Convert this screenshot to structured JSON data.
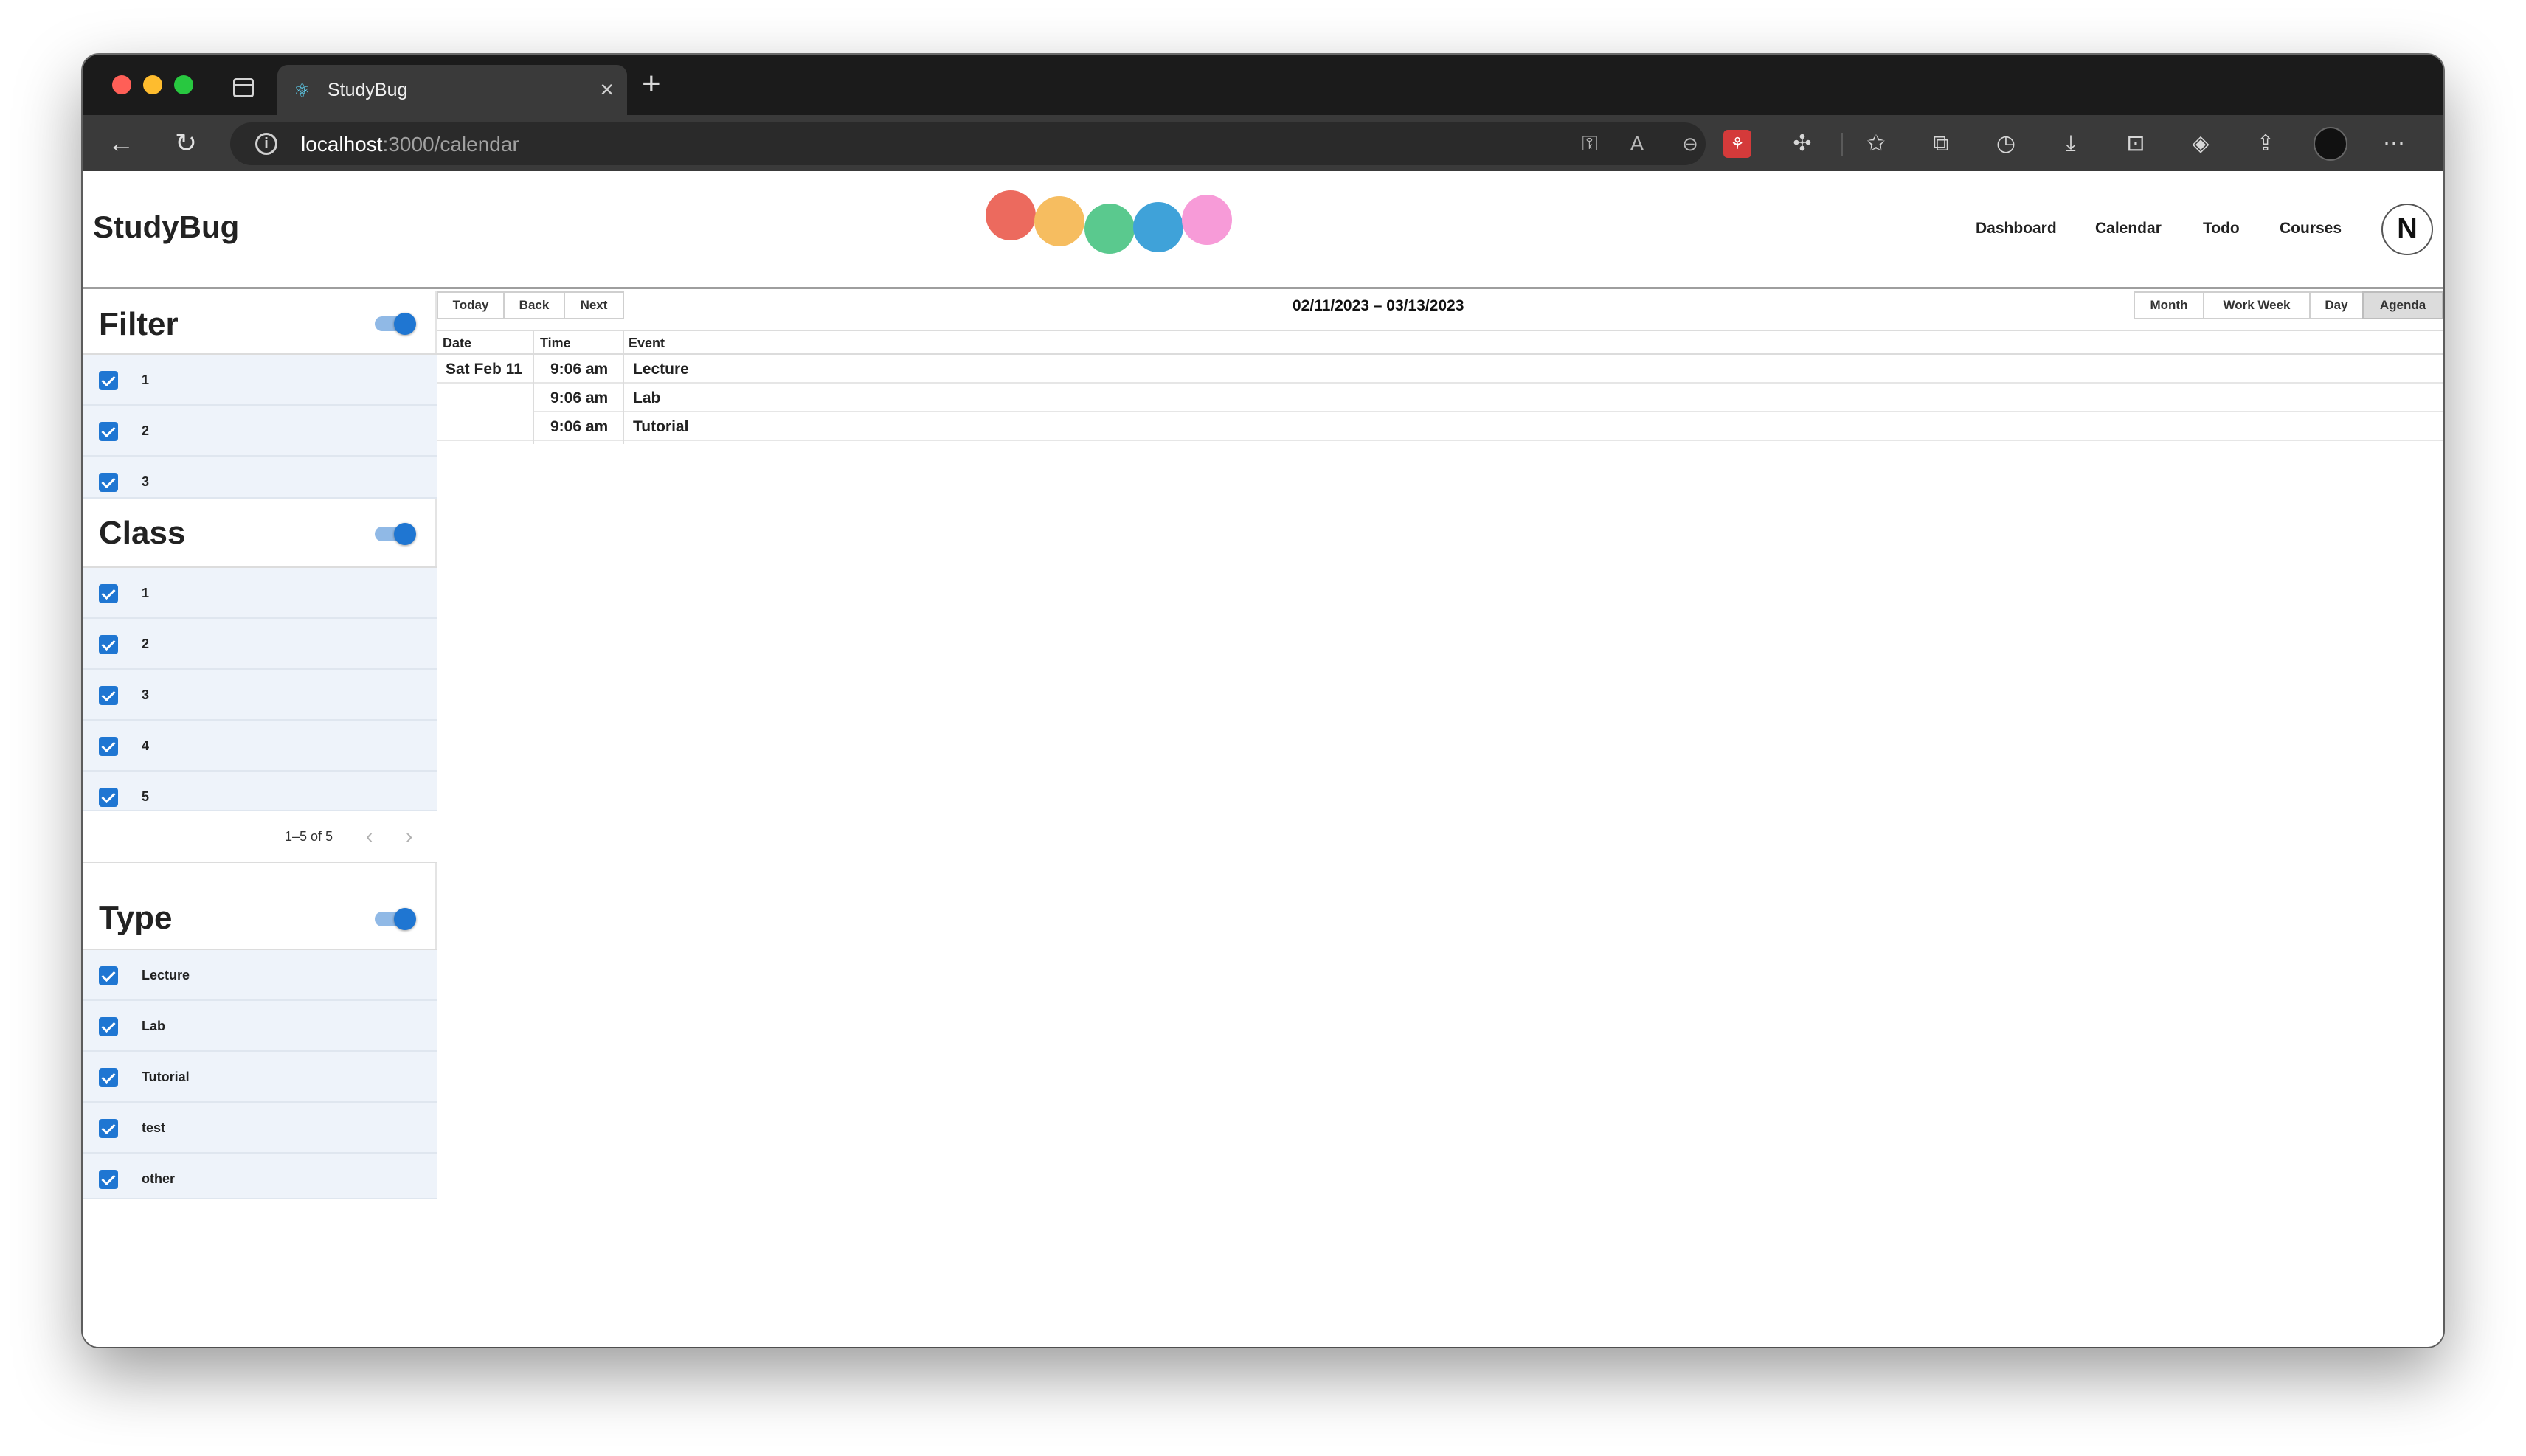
{
  "browser": {
    "tab_title": "StudyBug",
    "tab_close": "×",
    "new_tab": "+",
    "url_host": "localhost",
    "url_path": ":3000/calendar",
    "icons": [
      "back-icon",
      "reload-icon",
      "site-info-icon",
      "key-icon",
      "read-aloud-icon",
      "zoom-out-icon",
      "favorite-add-icon",
      "extension-red-icon",
      "extensions-icon",
      "favorites-icon",
      "collections-icon",
      "history-icon",
      "download-icon",
      "screenshot-icon",
      "performance-icon",
      "share-icon",
      "profile-avatar",
      "more-icon"
    ]
  },
  "app": {
    "brand": "StudyBug",
    "logo_colors": [
      "#ec6a5e",
      "#f6bd60",
      "#5ac98e",
      "#3fa2d9",
      "#f79bd8"
    ],
    "nav": [
      "Dashboard",
      "Calendar",
      "Todo",
      "Courses"
    ],
    "avatar_letter": "N"
  },
  "filters": {
    "filter": {
      "title": "Filter",
      "enabled": true,
      "items": [
        "1",
        "2",
        "3"
      ]
    },
    "class": {
      "title": "Class",
      "enabled": true,
      "items": [
        "1",
        "2",
        "3",
        "4",
        "5"
      ],
      "pagination": "1–5 of 5"
    },
    "type": {
      "title": "Type",
      "enabled": true,
      "items": [
        "Lecture",
        "Lab",
        "Tutorial",
        "test",
        "other"
      ]
    }
  },
  "calendar": {
    "nav_buttons": [
      "Today",
      "Back",
      "Next"
    ],
    "range": "02/11/2023 – 03/13/2023",
    "views": [
      "Month",
      "Work Week",
      "Day",
      "Agenda"
    ],
    "active_view": "Agenda",
    "columns": [
      "Date",
      "Time",
      "Event"
    ],
    "events": [
      {
        "date": "Sat Feb 11",
        "time": "9:06 am",
        "event": "Lecture"
      },
      {
        "date": "",
        "time": "9:06 am",
        "event": "Lab"
      },
      {
        "date": "",
        "time": "9:06 am",
        "event": "Tutorial"
      }
    ]
  }
}
